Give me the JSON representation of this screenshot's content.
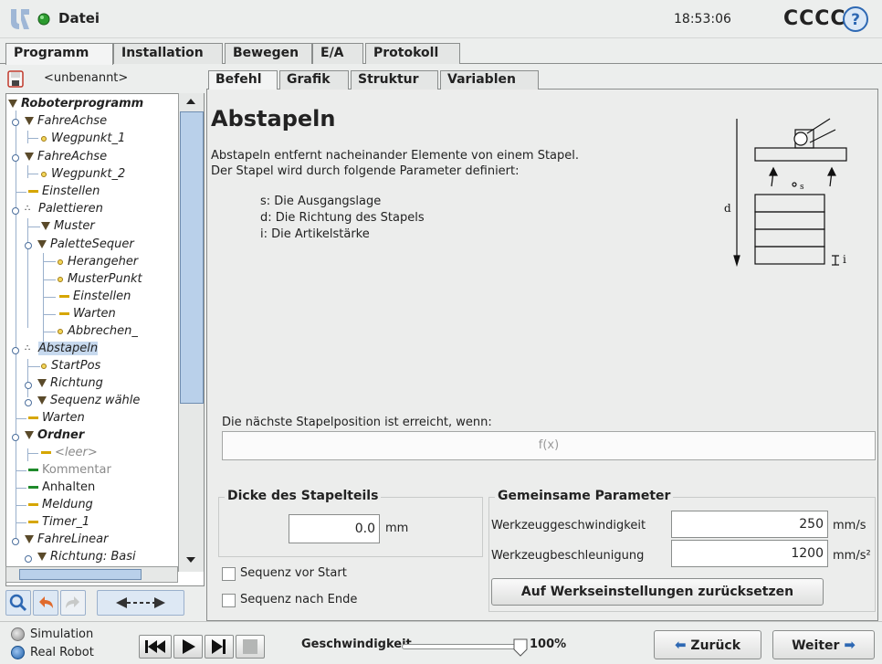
{
  "titlebar": {
    "menu_label": "Datei",
    "clock": "18:53:06",
    "robot_name": "CCCC"
  },
  "main_tabs": [
    {
      "label": "Programm",
      "active": true
    },
    {
      "label": "Installation",
      "active": false
    },
    {
      "label": "Bewegen",
      "active": false
    },
    {
      "label": "E/A",
      "active": false
    },
    {
      "label": "Protokoll",
      "active": false
    }
  ],
  "program": {
    "name": "<unbenannt>"
  },
  "tree": [
    {
      "label": "Roboterprogramm",
      "icon": "triangle-icon"
    },
    {
      "label": "FahreAchse",
      "icon": "triangle-icon"
    },
    {
      "label": "Wegpunkt_1",
      "icon": "waypoint-icon"
    },
    {
      "label": "FahreAchse",
      "icon": "triangle-icon"
    },
    {
      "label": "Wegpunkt_2",
      "icon": "waypoint-icon"
    },
    {
      "label": "Einstellen",
      "icon": "dash-icon"
    },
    {
      "label": "Palettieren",
      "icon": "pallet-icon"
    },
    {
      "label": "Muster",
      "icon": "triangle-icon"
    },
    {
      "label": "PaletteSequer",
      "icon": "triangle-icon"
    },
    {
      "label": "Herangeher",
      "icon": "waypoint-icon"
    },
    {
      "label": "MusterPunkt",
      "icon": "waypoint-icon"
    },
    {
      "label": "Einstellen",
      "icon": "dash-icon"
    },
    {
      "label": "Warten",
      "icon": "dash-icon"
    },
    {
      "label": "Abbrechen_",
      "icon": "waypoint-icon"
    },
    {
      "label": "Abstapeln",
      "icon": "pallet-icon",
      "selected": true
    },
    {
      "label": "StartPos",
      "icon": "waypoint-icon"
    },
    {
      "label": "Richtung",
      "icon": "triangle-icon"
    },
    {
      "label": "Sequenz wähle",
      "icon": "triangle-icon"
    },
    {
      "label": "Warten",
      "icon": "dash-icon"
    },
    {
      "label": "Ordner",
      "icon": "triangle-icon"
    },
    {
      "label": "<leer>",
      "icon": "dash-icon"
    },
    {
      "label": "Kommentar",
      "icon": "dash-icon"
    },
    {
      "label": "Anhalten",
      "icon": "dash-icon"
    },
    {
      "label": "Meldung",
      "icon": "dash-icon"
    },
    {
      "label": "Timer_1",
      "icon": "dash-icon"
    },
    {
      "label": "FahreLinear",
      "icon": "triangle-icon"
    },
    {
      "label": "Richtung: Basi",
      "icon": "triangle-icon"
    }
  ],
  "sub_tabs": [
    {
      "label": "Befehl",
      "active": true
    },
    {
      "label": "Grafik",
      "active": false
    },
    {
      "label": "Struktur",
      "active": false
    },
    {
      "label": "Variablen",
      "active": false
    }
  ],
  "content": {
    "title": "Abstapeln",
    "desc_line1": "Abstapeln entfernt nacheinander Elemente von einem Stapel.",
    "desc_line2": "Der Stapel wird durch folgende Parameter definiert:",
    "param_s": "s: Die Ausgangslage",
    "param_d": "d: Die Richtung des Stapels",
    "param_i": "i: Die Artikelstärke",
    "diagram_label_d": "d",
    "diagram_label_s": "s",
    "diagram_label_i": "i",
    "condition_label": "Die nächste Stapelposition ist erreicht, wenn:",
    "condition_placeholder": "f(x)"
  },
  "thickness": {
    "legend": "Dicke des Stapelteils",
    "value": "0.0",
    "unit": "mm"
  },
  "common": {
    "legend": "Gemeinsame Parameter",
    "tool_speed_label": "Werkzeuggeschwindigkeit",
    "tool_speed_value": "250",
    "tool_speed_unit": "mm/s",
    "tool_accel_label": "Werkzeugbeschleunigung",
    "tool_accel_value": "1200",
    "tool_accel_unit": "mm/s²",
    "reset_label": "Auf Werkseinstellungen zurücksetzen"
  },
  "checkboxes": {
    "seq_before": "Sequenz vor Start",
    "seq_after": "Sequenz nach Ende"
  },
  "bottom": {
    "simulation_label": "Simulation",
    "real_robot_label": "Real Robot",
    "speed_label": "Geschwindigkeit",
    "speed_value": "100%",
    "speed_fraction": 1.0,
    "back_label": "Zurück",
    "next_label": "Weiter"
  },
  "colors": {
    "accent_blue": "#3a6fb0",
    "selection": "#c7d9ee",
    "tree_triangle": "#5a4a2a",
    "waypoint_yellow": "#f3d65a"
  }
}
